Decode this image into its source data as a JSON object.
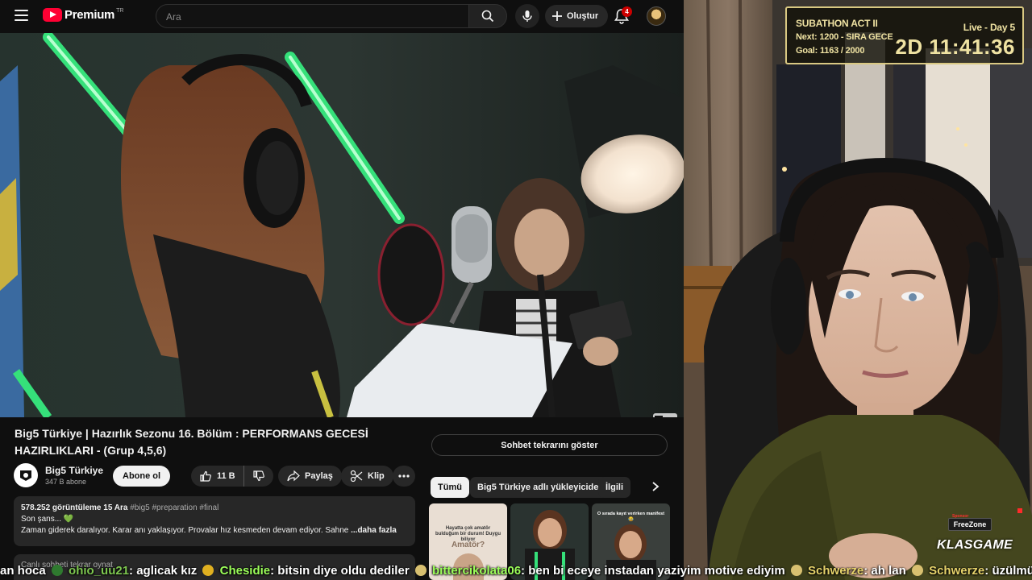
{
  "header": {
    "logo_text": "Premium",
    "logo_country": "TR",
    "search_placeholder": "Ara",
    "create_label": "Oluştur",
    "notification_count": "4"
  },
  "video": {
    "title": "Big5 Türkiye | Hazırlık Sezonu 16. Bölüm : PERFORMANS GECESİ HAZIRLIKLARI - (Grup 4,5,6)",
    "channel_name": "Big5 Türkiye",
    "channel_subs": "347 B abone",
    "subscribe_label": "Abone ol",
    "like_count": "11 B",
    "share_label": "Paylaş",
    "clip_label": "Klip",
    "description": {
      "meta": "578.252 görüntüleme  15 Ara",
      "tags": "#big5 #preparation #final",
      "line1": "Son şans... 💚",
      "line2": "Zaman giderek daralıyor. Karar anı yaklaşıyor. Provalar hız kesmeden devam ediyor. Sahne",
      "more": "...daha fazla"
    },
    "chat_replay_collapsed": "Canlı sohbeti tekrar oynat"
  },
  "sidebar": {
    "chat_replay_button": "Sohbet tekrarını göster",
    "chips": [
      "Tümü",
      "Big5 Türkiye adlı yükleyiciden",
      "İlgili"
    ],
    "thumbs": [
      {
        "caption_top": "Hayatta çok amatör bulduğum bir durum! Duygu biliyor",
        "caption_mid": "Amatör?"
      },
      {
        "caption_top": "",
        "caption_mid": ""
      },
      {
        "caption_top": "O sırada kayıt verirken manifest 😂",
        "caption_mid": ""
      }
    ]
  },
  "overlay": {
    "subathon_title": "SUBATHON ACT II",
    "subathon_next": "Next: 1200 - SIRA GECE",
    "subathon_goal": "Goal: 1163 / 2000",
    "subathon_live": "Live - Day 5",
    "subathon_timer": "2D  11:41:36",
    "freezone_label": "FreeZone",
    "freezone_tag": "Sponsor",
    "brand": "KLASGAME"
  },
  "chat_ticker": [
    {
      "user": "",
      "text": "an hoca",
      "color": "#ffffff"
    },
    {
      "user": "ohio_uu21",
      "text": ": aglicak kız",
      "color": "#7ec850"
    },
    {
      "user": "Chesidie",
      "text": ": bitsin diye oldu dediler",
      "color": "#9cff5a"
    },
    {
      "user": "bittercikolata06",
      "text": ": ben bi eceye instadan yaziyim motive ediyim",
      "color": "#9cff5a"
    },
    {
      "user": "Schwerze",
      "text": ": ah lan",
      "color": "#e7d36b"
    },
    {
      "user": "Schwerze",
      "text": ": üzülmüş",
      "color": "#e7d36b"
    }
  ],
  "colors": {
    "accent_red": "#ff0033",
    "badge_red": "#cc0000",
    "overlay_gold": "#efe2a2",
    "neon_green": "#35e07a"
  },
  "icons": {
    "menu": "hamburger-icon",
    "search": "search-icon",
    "mic": "mic-icon",
    "create": "plus-icon",
    "notifications": "bell-icon",
    "like": "thumbs-up-icon",
    "dislike": "thumbs-down-icon",
    "share": "share-arrow-icon",
    "clip": "scissors-icon",
    "more": "more-horizontal-icon",
    "next": "chevron-right-icon"
  }
}
